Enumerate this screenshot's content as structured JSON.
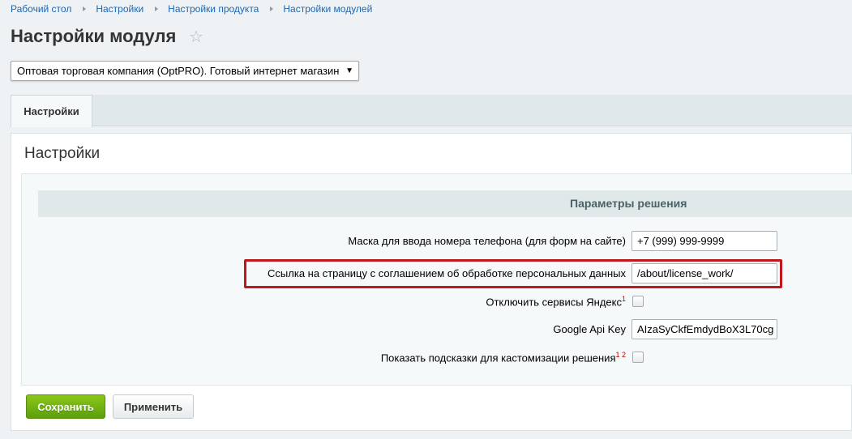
{
  "breadcrumb": [
    "Рабочий стол",
    "Настройки",
    "Настройки продукта",
    "Настройки модулей"
  ],
  "page_title": "Настройки модуля",
  "site_select": {
    "value": "Оптовая торговая компания (OptPRO). Готовый интернет магазин"
  },
  "tabs": [
    {
      "label": "Настройки"
    }
  ],
  "panel_title": "Настройки",
  "section_header": "Параметры решения",
  "rows": {
    "phone_mask": {
      "label": "Маска для ввода номера телефона (для форм на сайте)",
      "value": "+7 (999) 999-9999"
    },
    "agreement_link": {
      "label": "Ссылка на страницу с соглашением об обработке персональных данных",
      "value": "/about/license_work/"
    },
    "yandex": {
      "label": "Отключить сервисы Яндекс",
      "note": "1",
      "checked": false
    },
    "google_key": {
      "label": "Google Api Key",
      "value": "AIzaSyCkfEmdydBoX3L70cg"
    },
    "hints": {
      "label": "Показать подсказки для кастомизации решения",
      "note": "1 2",
      "checked": false
    }
  },
  "buttons": {
    "save": "Сохранить",
    "apply": "Применить"
  },
  "colors": {
    "highlight": "#c0171c",
    "save_button": "#6cb012",
    "link": "#2067b0"
  }
}
